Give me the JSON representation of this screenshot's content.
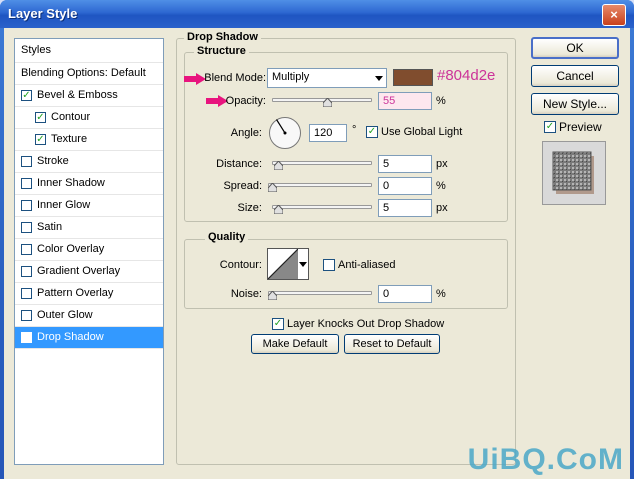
{
  "window": {
    "title": "Layer Style",
    "close_glyph": "×"
  },
  "styles_list": {
    "header": "Styles",
    "items": [
      {
        "label": "Blending Options: Default",
        "has_checkbox": false,
        "checked": false,
        "indent": false,
        "selected": false
      },
      {
        "label": "Bevel & Emboss",
        "has_checkbox": true,
        "checked": true,
        "indent": false,
        "selected": false
      },
      {
        "label": "Contour",
        "has_checkbox": true,
        "checked": true,
        "indent": true,
        "selected": false
      },
      {
        "label": "Texture",
        "has_checkbox": true,
        "checked": true,
        "indent": true,
        "selected": false
      },
      {
        "label": "Stroke",
        "has_checkbox": true,
        "checked": false,
        "indent": false,
        "selected": false
      },
      {
        "label": "Inner Shadow",
        "has_checkbox": true,
        "checked": false,
        "indent": false,
        "selected": false
      },
      {
        "label": "Inner Glow",
        "has_checkbox": true,
        "checked": false,
        "indent": false,
        "selected": false
      },
      {
        "label": "Satin",
        "has_checkbox": true,
        "checked": false,
        "indent": false,
        "selected": false
      },
      {
        "label": "Color Overlay",
        "has_checkbox": true,
        "checked": false,
        "indent": false,
        "selected": false
      },
      {
        "label": "Gradient Overlay",
        "has_checkbox": true,
        "checked": false,
        "indent": false,
        "selected": false
      },
      {
        "label": "Pattern Overlay",
        "has_checkbox": true,
        "checked": false,
        "indent": false,
        "selected": false
      },
      {
        "label": "Outer Glow",
        "has_checkbox": true,
        "checked": false,
        "indent": false,
        "selected": false
      },
      {
        "label": "Drop Shadow",
        "has_checkbox": true,
        "checked": true,
        "indent": false,
        "selected": true
      }
    ]
  },
  "drop_shadow": {
    "title": "Drop Shadow",
    "structure": {
      "title": "Structure",
      "blend_mode_label": "Blend Mode:",
      "blend_mode_value": "Multiply",
      "color_hex": "#804d2e",
      "color_annotation": "#804d2e",
      "opacity_label": "Opacity:",
      "opacity_value": "55",
      "opacity_level": 0.55,
      "opacity_unit": "%",
      "angle_label": "Angle:",
      "angle_value": "120",
      "angle_unit": "°",
      "use_global_light_label": "Use Global Light",
      "use_global_light_checked": true,
      "distance_label": "Distance:",
      "distance_value": "5",
      "distance_unit": "px",
      "spread_label": "Spread:",
      "spread_value": "0",
      "spread_unit": "%",
      "size_label": "Size:",
      "size_value": "5",
      "size_unit": "px"
    },
    "quality": {
      "title": "Quality",
      "contour_label": "Contour:",
      "anti_aliased_label": "Anti-aliased",
      "anti_aliased_checked": false,
      "noise_label": "Noise:",
      "noise_value": "0",
      "noise_unit": "%"
    },
    "layer_knocks_out_label": "Layer Knocks Out Drop Shadow",
    "layer_knocks_out_checked": true,
    "make_default_label": "Make Default",
    "reset_default_label": "Reset to Default"
  },
  "right_panel": {
    "ok_label": "OK",
    "cancel_label": "Cancel",
    "new_style_label": "New Style...",
    "preview_label": "Preview",
    "preview_checked": true
  },
  "watermark": {
    "text": "UiBQ.CoM"
  },
  "colors": {
    "accent_arrow": "#e8147e",
    "annotation_text": "#cc3399",
    "selected_row": "#3399ff",
    "opacity_field_bg": "#fde7ee"
  },
  "icons": {
    "check": "✓",
    "dropdown": "▼"
  }
}
